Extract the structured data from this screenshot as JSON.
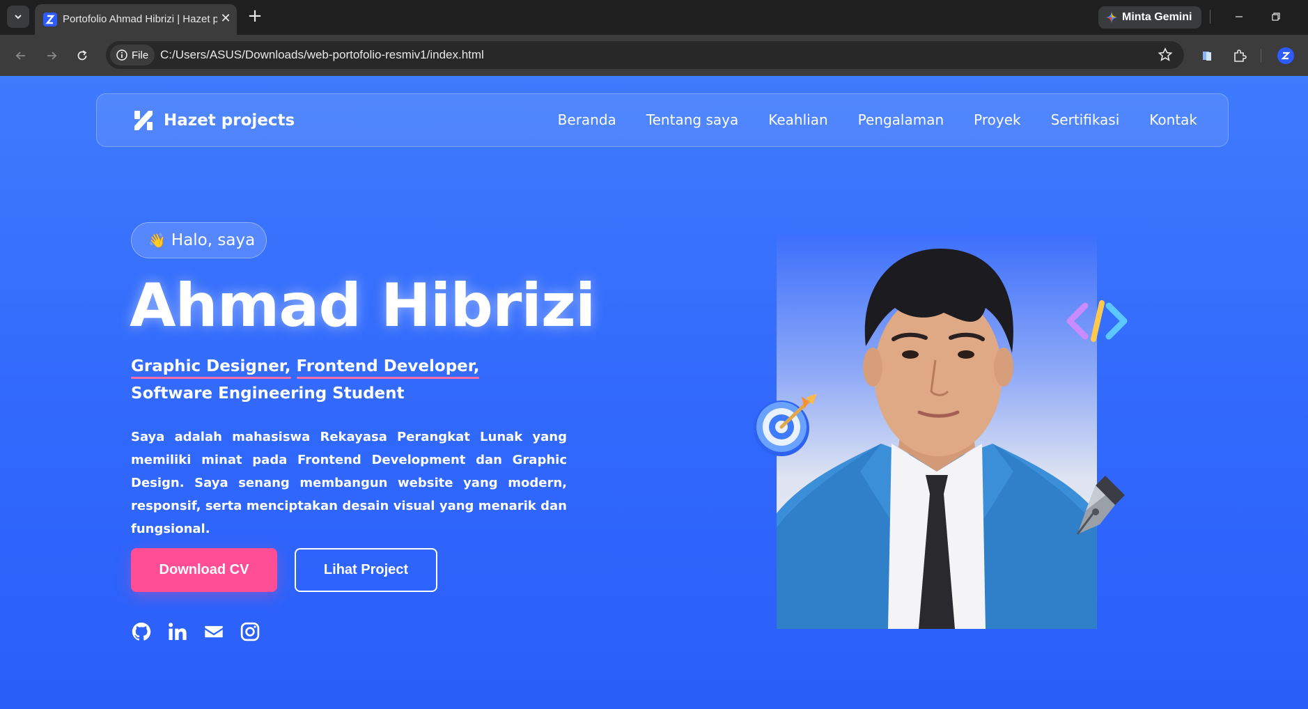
{
  "browser": {
    "tab_title": "Portofolio Ahmad Hibrizi | Hazet projects",
    "gemini_label": "Minta Gemini",
    "file_chip": "File",
    "url": "C:/Users/ASUS/Downloads/web-portofolio-resmiv1/index.html"
  },
  "navbar": {
    "brand": "Hazet projects",
    "links": [
      "Beranda",
      "Tentang saya",
      "Keahlian",
      "Pengalaman",
      "Proyek",
      "Sertifikasi",
      "Kontak"
    ]
  },
  "hero": {
    "greeting": "Halo, saya",
    "greeting_emoji": "👋",
    "name": "Ahmad Hibrizi",
    "roles": [
      "Graphic Designer,",
      "Frontend Developer,",
      "Software Engineering Student"
    ],
    "description": "Saya adalah mahasiswa Rekayasa Perangkat Lunak yang memiliki minat pada Frontend Development dan Graphic Design. Saya senang membangun website yang modern, responsif, serta menciptakan desain visual yang menarik dan fungsional.",
    "primary_button": "Download CV",
    "secondary_button": "Lihat Project",
    "socials": [
      "github-icon",
      "linkedin-icon",
      "email-icon",
      "instagram-icon"
    ]
  },
  "colors": {
    "page_bg": "#3168fc",
    "accent_pink": "#ff4d96",
    "underline_pink": "#ff6fa8"
  }
}
